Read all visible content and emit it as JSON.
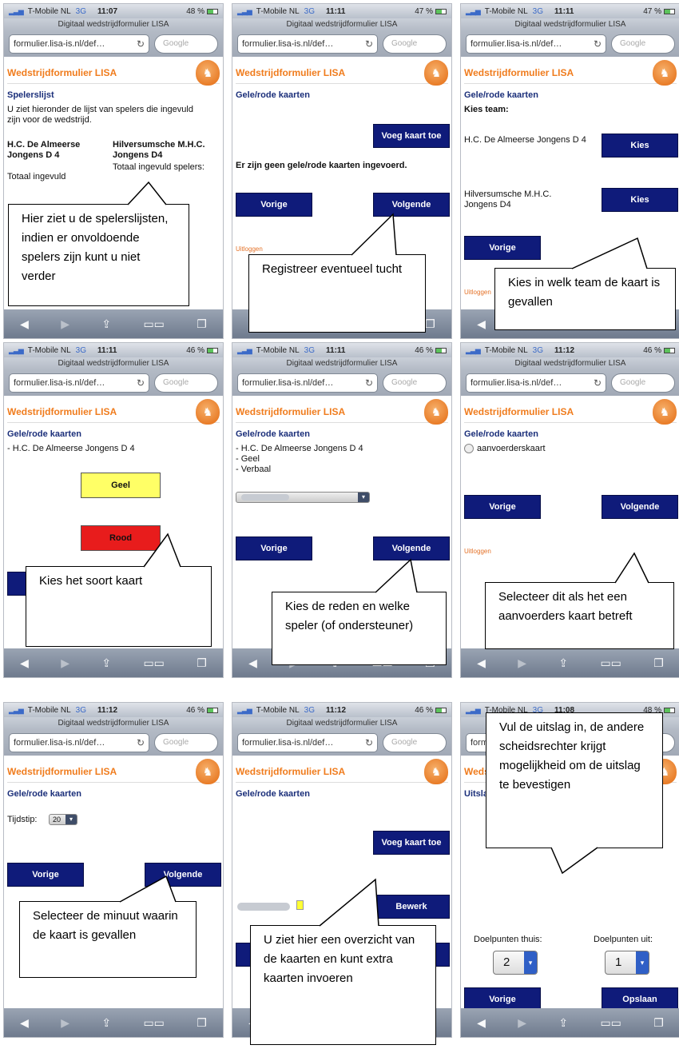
{
  "common": {
    "carrier": "T-Mobile NL",
    "network": "3G",
    "page_title": "Digitaal wedstrijdformulier LISA",
    "url": "formulier.lisa-is.nl/def…",
    "search_placeholder": "Google",
    "site_title": "Wedstrijdformulier LISA",
    "section_title": "Gele/rode kaarten",
    "vorige": "Vorige",
    "volgende": "Volgende",
    "logout": "Uitloggen"
  },
  "toolbar_icons": [
    "back-icon",
    "forward-icon",
    "share-icon",
    "bookmarks-icon",
    "tabs-icon"
  ],
  "screens": [
    {
      "time": "11:07",
      "battery": "48 %",
      "section_title": "Spelerslijst",
      "intro": "U ziet hieronder de lijst van spelers die ingevuld zijn voor de wedstrijd.",
      "team_home": "H.C. De Almeerse Jongens D 4",
      "team_away": "Hilversumsche M.H.C. Jongens D4",
      "total_home": "Totaal ingevuld",
      "total_away": "Totaal ingevuld spelers:",
      "callout": "Hier ziet u de spelerslijsten, indien er onvoldoende spelers zijn kunt u niet verder"
    },
    {
      "time": "11:11",
      "battery": "47 %",
      "add_card": "Voeg kaart toe",
      "empty": "Er zijn geen gele/rode kaarten ingevoerd.",
      "callout": "Registreer eventueel tucht"
    },
    {
      "time": "11:11",
      "battery": "47 %",
      "choose_team": "Kies team:",
      "team_home": "H.C. De Almeerse Jongens D 4",
      "team_away": "Hilversumsche M.H.C. Jongens D4",
      "kies": "Kies",
      "callout": "Kies in welk team de kaart is gevallen"
    },
    {
      "time": "11:11",
      "battery": "46 %",
      "team_line": "- H.C. De Almeerse Jongens D 4",
      "geel": "Geel",
      "rood": "Rood",
      "callout": "Kies het soort kaart"
    },
    {
      "time": "11:11",
      "battery": "46 %",
      "line1": "- H.C. De Almeerse Jongens D 4",
      "line2": "- Geel",
      "line3": "- Verbaal",
      "callout": "Kies de reden en welke speler (of ondersteuner)"
    },
    {
      "time": "11:12",
      "battery": "46 %",
      "checkbox_label": "aanvoerderskaart",
      "callout": "Selecteer dit als het een aanvoerders kaart betreft"
    },
    {
      "time": "11:12",
      "battery": "46 %",
      "tijdstip_label": "Tijdstip:",
      "tijdstip_value": "20",
      "callout": "Selecteer de minuut waarin de kaart is gevallen"
    },
    {
      "time": "11:12",
      "battery": "46 %",
      "add_card": "Voeg kaart toe",
      "bewerk": "Bewerk",
      "callout": "U ziet hier een overzicht van de kaarten en kunt extra kaarten invoeren"
    },
    {
      "time": "11:08",
      "battery": "48 %",
      "section_title": "Uitslag",
      "goals_home_label": "Doelpunten thuis:",
      "goals_away_label": "Doelpunten uit:",
      "goals_home": "2",
      "goals_away": "1",
      "opslaan": "Opslaan",
      "callout": "Vul de uitslag in, de andere scheidsrechter krijgt mogelijkheid om de uitslag te bevestigen"
    }
  ],
  "colors": {
    "accent_orange": "#f07c1d",
    "button_navy": "#0f1b7a",
    "section_navy": "#1b2f7a",
    "card_yellow": "#ffff66",
    "card_red": "#e81c1c"
  }
}
